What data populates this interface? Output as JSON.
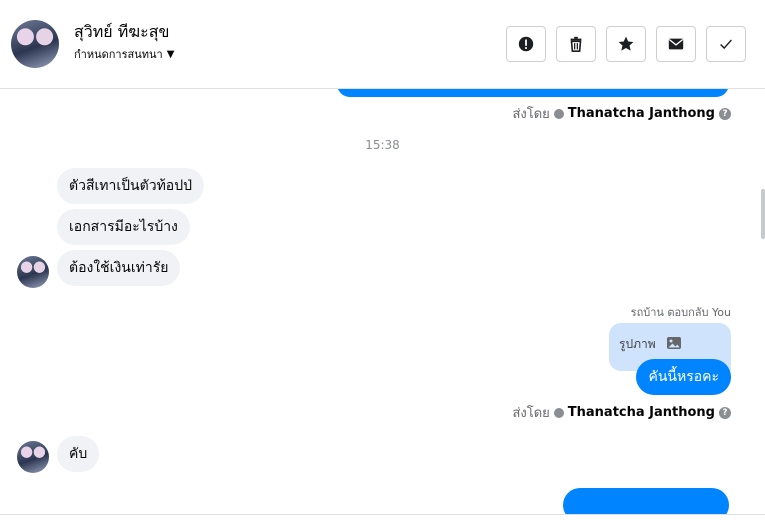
{
  "header": {
    "title": "สุวิทย์ ทีฆะสุข",
    "subtitle": "กำหนดการสนทนา",
    "actions": [
      "report-icon",
      "trash-icon",
      "star-icon",
      "mail-icon",
      "check-icon"
    ]
  },
  "thread": {
    "sent_by_label": "ส่งโดย",
    "sent_by_name": "Thanatcha Janthong",
    "timestamp": "15:38",
    "incoming": [
      "ตัวสีเทาเป็นตัวท้อปป่",
      "เอกสารมีอะไรบ้าง",
      "ต้องใช้เงินเท่ารัย",
      "คับ"
    ],
    "reply_note": "รถบ้าน ตอบกลับ You",
    "quote_text": "รูปภาพ",
    "outgoing": "คันนี้หรอคะ"
  }
}
